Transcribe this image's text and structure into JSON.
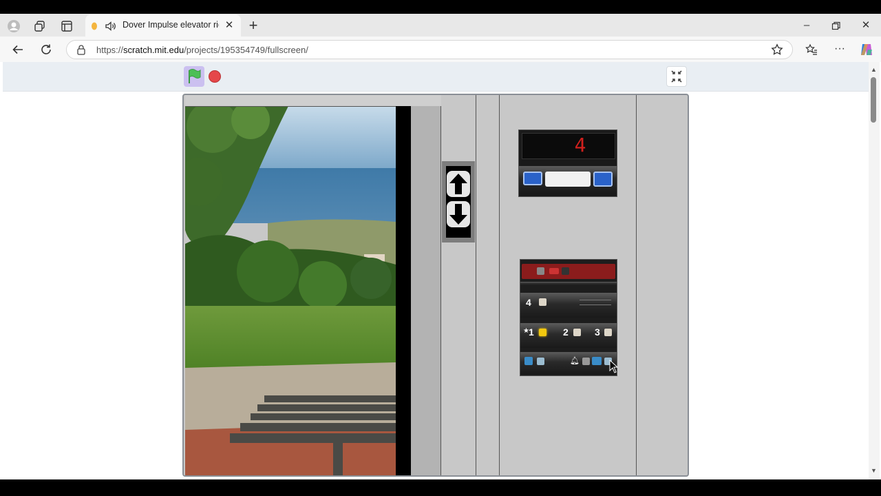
{
  "browser": {
    "tab_title": "Dover Impulse elevator ride",
    "url_prefix": "https://",
    "url_domain": "scratch.mit.edu",
    "url_path": "/projects/195354749/fullscreen/"
  },
  "elevator": {
    "display_floor": "4",
    "floor_buttons": {
      "b4": "4",
      "b1": "1",
      "b2": "2",
      "b3": "3"
    }
  },
  "icons": {
    "profile": "profile-icon",
    "workspaces": "workspaces-icon",
    "tab_actions": "tab-actions-icon",
    "audio": "speaker-icon",
    "back": "back-arrow-icon",
    "refresh": "refresh-icon",
    "favorite": "star-icon",
    "favorites": "favorites-icon",
    "more": "more-icon",
    "copilot": "copilot-icon"
  },
  "colors": {
    "flag_bg": "#cbc0f0",
    "flag": "#4cbf56",
    "stop": "#e5474a",
    "display_digit": "#d0201d",
    "call_button_lit": "#f2c80f"
  }
}
